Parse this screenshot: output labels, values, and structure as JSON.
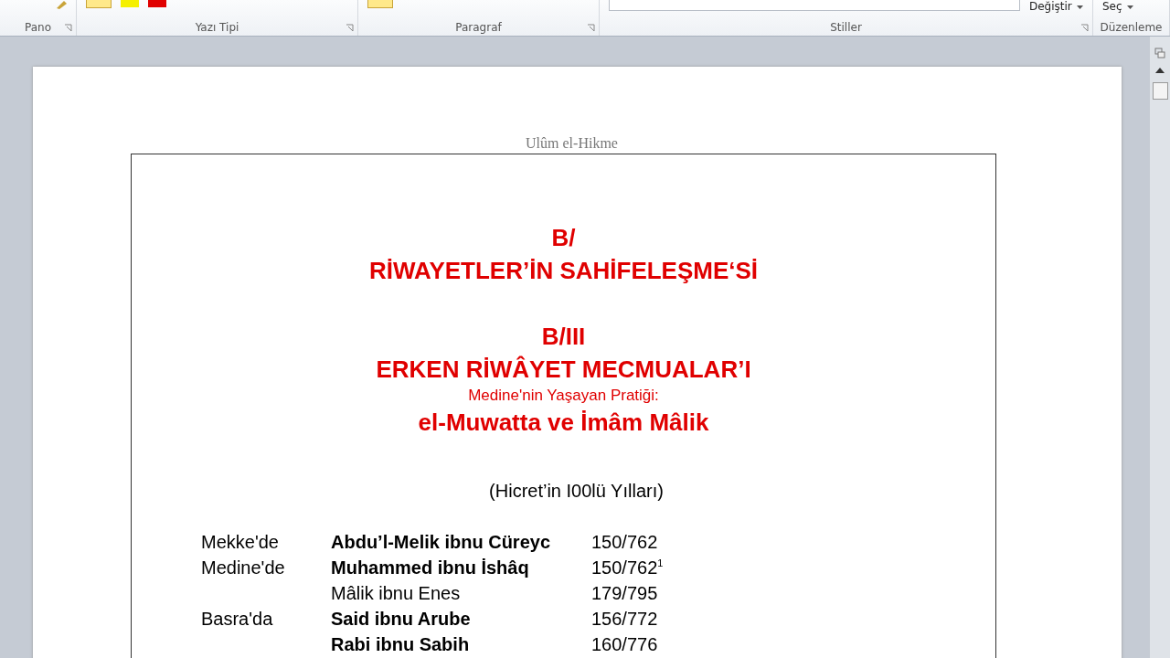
{
  "ribbon": {
    "groups": [
      {
        "label": "Pano"
      },
      {
        "label": "Yazı Tipi"
      },
      {
        "label": "Paragraf"
      },
      {
        "label": "Stiller"
      },
      {
        "label": "Düzenleme"
      }
    ],
    "replace_button": "Değiştir",
    "select_button": "Seç"
  },
  "document": {
    "header": "Ulûm el-Hikme",
    "headings": [
      {
        "kind": "large",
        "text": "B/"
      },
      {
        "kind": "large",
        "text": "RİWAYETLER’İN SAHİFELEŞME‘Sİ"
      },
      {
        "kind": "gap"
      },
      {
        "kind": "large",
        "text": "B/III"
      },
      {
        "kind": "large",
        "text": "ERKEN RİWÂYET MECMUALAR’I"
      },
      {
        "kind": "small",
        "text": "Medine'nin Yaşayan Pratiği:"
      },
      {
        "kind": "large",
        "text": "el-Muwatta ve İmâm Mâlik"
      }
    ],
    "subtitle": "(Hicret’in I00lü Yılları)",
    "rows": [
      {
        "place": "Mekke'de",
        "name": "Abdu’l-Melik ibnu Cüreyc",
        "bold": true,
        "date": "150/762"
      },
      {
        "place": "Medine'de",
        "name": "Muhammed ibnu İshâq",
        "bold": true,
        "date": "150/762$^{1}$"
      },
      {
        "name": "Mâlik ibnu Enes",
        "bold": false,
        "date": "179/795"
      },
      {
        "place": "Basra'da",
        "name": "Said ibnu Arube",
        "bold": true,
        "date": "156/772"
      },
      {
        "name": "Rabi ibnu Sabih",
        "bold": true,
        "date": "160/776"
      }
    ]
  }
}
